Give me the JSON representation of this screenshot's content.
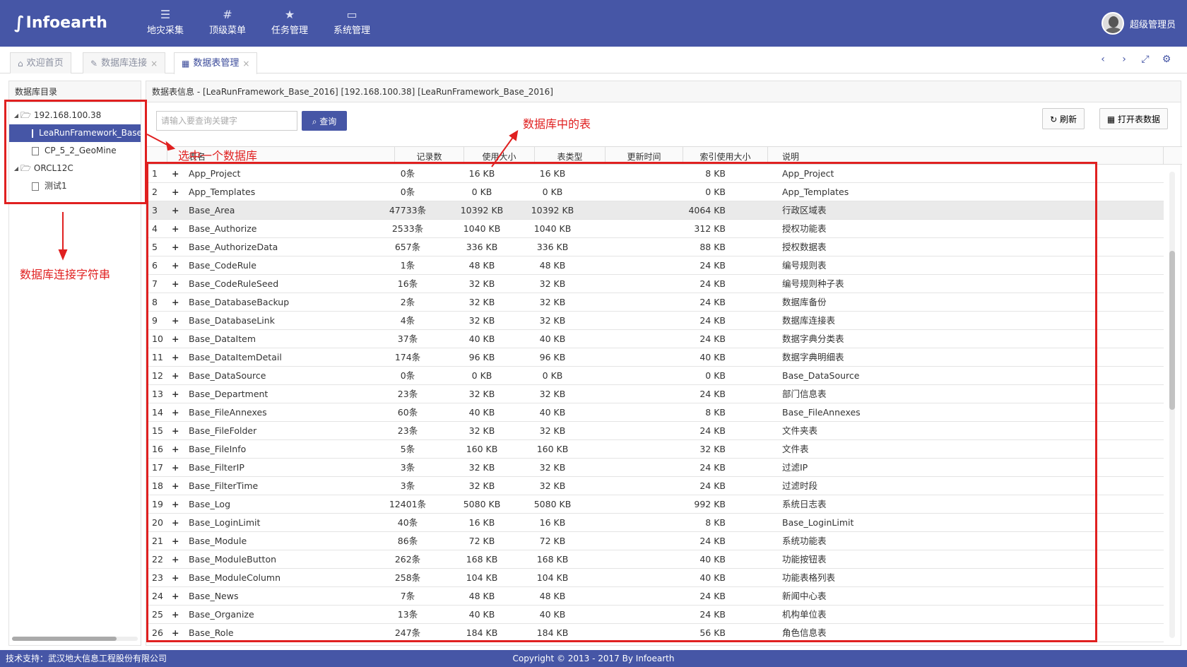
{
  "header": {
    "logo": "Infoearth",
    "nav": [
      {
        "label": "地灾采集",
        "icon": "menu-icon"
      },
      {
        "label": "顶级菜单",
        "icon": "hash-icon"
      },
      {
        "label": "任务管理",
        "icon": "star-icon"
      },
      {
        "label": "系统管理",
        "icon": "monitor-icon"
      }
    ],
    "user": "超级管理员"
  },
  "tabs": [
    {
      "label": "欢迎首页",
      "icon": "home-icon",
      "closable": false
    },
    {
      "label": "数据库连接",
      "icon": "plug-icon",
      "closable": true
    },
    {
      "label": "数据表管理",
      "icon": "table-icon",
      "closable": true,
      "active": true
    }
  ],
  "left": {
    "title": "数据库目录",
    "tree": [
      {
        "label": "192.168.100.38",
        "level": 0,
        "type": "folder"
      },
      {
        "label": "LeaRunFramework_Base_2016",
        "level": 1,
        "type": "file",
        "selected": true
      },
      {
        "label": "CP_5_2_GeoMine",
        "level": 1,
        "type": "file"
      },
      {
        "label": "ORCL12C",
        "level": 0,
        "type": "folder"
      },
      {
        "label": "测试1",
        "level": 1,
        "type": "file"
      }
    ]
  },
  "right": {
    "title": "数据表信息 - [LeaRunFramework_Base_2016] [192.168.100.38] [LeaRunFramework_Base_2016]",
    "search_placeholder": "请输入要查询关键字",
    "query_label": "查询",
    "refresh_label": "刷新",
    "open_label": "打开表数据",
    "columns": [
      "表名",
      "记录数",
      "使用大小",
      "表类型",
      "更新时间",
      "索引使用大小",
      "说明"
    ],
    "rows": [
      [
        "1",
        "App_Project",
        "0条",
        "16 KB",
        "16 KB",
        "8 KB",
        "App_Project"
      ],
      [
        "2",
        "App_Templates",
        "0条",
        "0 KB",
        "0 KB",
        "0 KB",
        "App_Templates"
      ],
      [
        "3",
        "Base_Area",
        "47733条",
        "10392 KB",
        "10392 KB",
        "4064 KB",
        "行政区域表"
      ],
      [
        "4",
        "Base_Authorize",
        "2533条",
        "1040 KB",
        "1040 KB",
        "312 KB",
        "授权功能表"
      ],
      [
        "5",
        "Base_AuthorizeData",
        "657条",
        "336 KB",
        "336 KB",
        "88 KB",
        "授权数据表"
      ],
      [
        "6",
        "Base_CodeRule",
        "1条",
        "48 KB",
        "48 KB",
        "24 KB",
        "编号规则表"
      ],
      [
        "7",
        "Base_CodeRuleSeed",
        "16条",
        "32 KB",
        "32 KB",
        "24 KB",
        "编号规则种子表"
      ],
      [
        "8",
        "Base_DatabaseBackup",
        "2条",
        "32 KB",
        "32 KB",
        "24 KB",
        "数据库备份"
      ],
      [
        "9",
        "Base_DatabaseLink",
        "4条",
        "32 KB",
        "32 KB",
        "24 KB",
        "数据库连接表"
      ],
      [
        "10",
        "Base_DataItem",
        "37条",
        "40 KB",
        "40 KB",
        "24 KB",
        "数据字典分类表"
      ],
      [
        "11",
        "Base_DataItemDetail",
        "174条",
        "96 KB",
        "96 KB",
        "40 KB",
        "数据字典明细表"
      ],
      [
        "12",
        "Base_DataSource",
        "0条",
        "0 KB",
        "0 KB",
        "0 KB",
        "Base_DataSource"
      ],
      [
        "13",
        "Base_Department",
        "23条",
        "32 KB",
        "32 KB",
        "24 KB",
        "部门信息表"
      ],
      [
        "14",
        "Base_FileAnnexes",
        "60条",
        "40 KB",
        "40 KB",
        "8 KB",
        "Base_FileAnnexes"
      ],
      [
        "15",
        "Base_FileFolder",
        "23条",
        "32 KB",
        "32 KB",
        "24 KB",
        "文件夹表"
      ],
      [
        "16",
        "Base_FileInfo",
        "5条",
        "160 KB",
        "160 KB",
        "32 KB",
        "文件表"
      ],
      [
        "17",
        "Base_FilterIP",
        "3条",
        "32 KB",
        "32 KB",
        "24 KB",
        "过滤IP"
      ],
      [
        "18",
        "Base_FilterTime",
        "3条",
        "32 KB",
        "32 KB",
        "24 KB",
        "过滤时段"
      ],
      [
        "19",
        "Base_Log",
        "12401条",
        "5080 KB",
        "5080 KB",
        "992 KB",
        "系统日志表"
      ],
      [
        "20",
        "Base_LoginLimit",
        "40条",
        "16 KB",
        "16 KB",
        "8 KB",
        "Base_LoginLimit"
      ],
      [
        "21",
        "Base_Module",
        "86条",
        "72 KB",
        "72 KB",
        "24 KB",
        "系统功能表"
      ],
      [
        "22",
        "Base_ModuleButton",
        "262条",
        "168 KB",
        "168 KB",
        "40 KB",
        "功能按钮表"
      ],
      [
        "23",
        "Base_ModuleColumn",
        "258条",
        "104 KB",
        "104 KB",
        "40 KB",
        "功能表格列表"
      ],
      [
        "24",
        "Base_News",
        "7条",
        "48 KB",
        "48 KB",
        "24 KB",
        "新闻中心表"
      ],
      [
        "25",
        "Base_Organize",
        "13条",
        "40 KB",
        "40 KB",
        "24 KB",
        "机构单位表"
      ],
      [
        "26",
        "Base_Role",
        "247条",
        "184 KB",
        "184 KB",
        "56 KB",
        "角色信息表"
      ]
    ]
  },
  "annotations": {
    "select_db": "选中一个数据库",
    "tables_in_db": "数据库中的表",
    "conn_string": "数据库连接字符串",
    "color": "#e02020"
  },
  "footer": {
    "support": "技术支持：武汉地大信息工程股份有限公司",
    "copyright": "Copyright © 2013 - 2017 By Infoearth"
  }
}
